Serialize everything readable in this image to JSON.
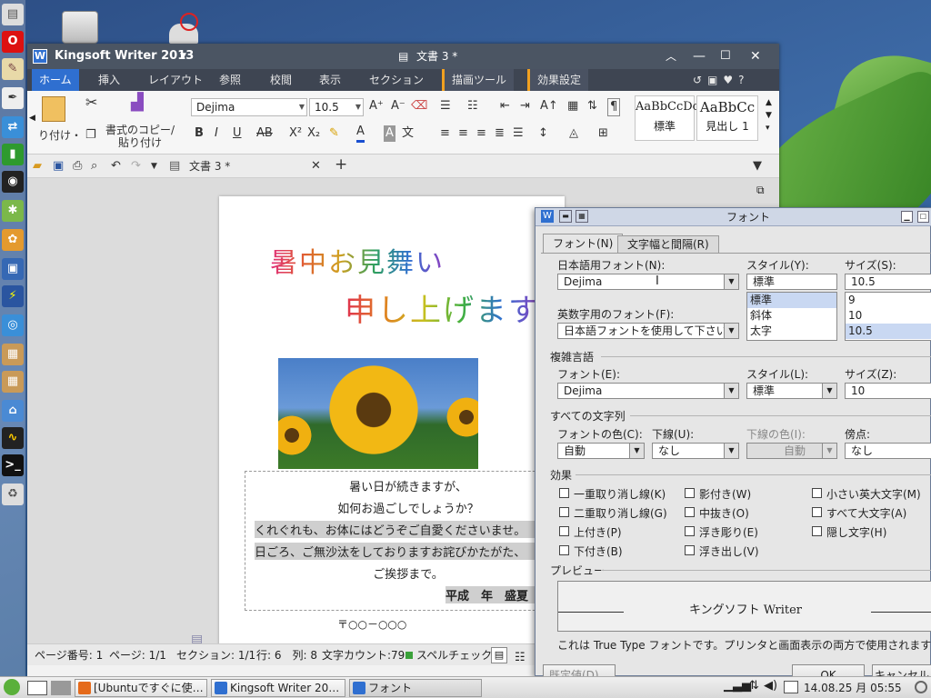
{
  "colors": {
    "accent": "#2f6fd0",
    "title_bar": "#4b5563"
  },
  "window": {
    "app_title": "Kingsoft Writer 2013",
    "doc_title": "文書 3 *",
    "menus": [
      "ホーム",
      "挿入",
      "レイアウト",
      "参照",
      "校閲",
      "表示",
      "セクション",
      "描画ツール",
      "効果設定"
    ],
    "ribbon": {
      "paste_label": "り付け・",
      "format_copy_label_1": "書式のコピー/",
      "format_copy_label_2": "貼り付け",
      "font_name": "Dejima",
      "font_size": "10.5",
      "styles": [
        {
          "sample": "AaBbCcDc",
          "name": "標準"
        },
        {
          "sample": "AaBbCc",
          "name": "見出し 1"
        }
      ]
    },
    "tab_label": "文書 3 *",
    "document": {
      "heading1": "暑中お見舞い",
      "heading2": "申し上げます",
      "lines": [
        "暑い日が続きますが、",
        "如何お過ごしでしょうか？",
        "くれぐれも、お体にはどうぞご自愛くださいませ。",
        "日ごろ、ご無沙汰をしておりますお詫びかたがた、",
        "ご挨拶まで。",
        "平成　年　盛夏"
      ],
      "address": "〒○○－○○○"
    },
    "status": {
      "page_no": "ページ番号: 1",
      "page": "ページ: 1/1",
      "section": "セクション: 1/1",
      "rowcol": "行: 6　列: 8",
      "chars": "文字カウント:79",
      "spell": "スペルチェック"
    }
  },
  "dialog": {
    "title": "フォント",
    "tabs": [
      "フォント(N)",
      "文字幅と間隔(R)"
    ],
    "jp_font_label": "日本語用フォント(N):",
    "jp_font_value": "Dejima",
    "style_label": "スタイル(Y):",
    "style_value": "標準",
    "style_options": [
      "標準",
      "斜体",
      "太字"
    ],
    "size_label": "サイズ(S):",
    "size_value": "10.5",
    "size_options": [
      "9",
      "10",
      "10.5"
    ],
    "en_font_label": "英数字用のフォント(F):",
    "en_font_value": "日本語フォントを使用して下さい",
    "complex_section": "複雑言語",
    "c_font_label": "フォント(E):",
    "c_font_value": "Dejima",
    "c_style_label": "スタイル(L):",
    "c_style_value": "標準",
    "c_size_label": "サイズ(Z):",
    "c_size_value": "10",
    "all_section": "すべての文字列",
    "color_label": "フォントの色(C):",
    "color_value": "自動",
    "underline_label": "下線(U):",
    "underline_value": "なし",
    "ucolor_label": "下線の色(I):",
    "ucolor_value": "自動",
    "emph_label": "傍点:",
    "emph_value": "なし",
    "effects_section": "効果",
    "effects": [
      [
        "一重取り消し線(K)",
        "影付き(W)",
        "小さい英大文字(M)"
      ],
      [
        "二重取り消し線(G)",
        "中抜き(O)",
        "すべて大文字(A)"
      ],
      [
        "上付き(P)",
        "浮き彫り(E)",
        "隠し文字(H)"
      ],
      [
        "下付き(B)",
        "浮き出し(V)",
        ""
      ]
    ],
    "preview_section": "プレビュー",
    "preview_text": "キングソフト Writer",
    "note": "これは True Type フォントです。プリンタと画面表示の両方で使用されます",
    "default_btn": "既定値(D)...",
    "ok_btn": "OK",
    "cancel_btn": "キャンセル"
  },
  "taskbar": {
    "tasks": [
      "[Ubuntuですぐに使…",
      "Kingsoft Writer 20…",
      "フォント"
    ],
    "clock": "14.08.25 月 05:55"
  }
}
